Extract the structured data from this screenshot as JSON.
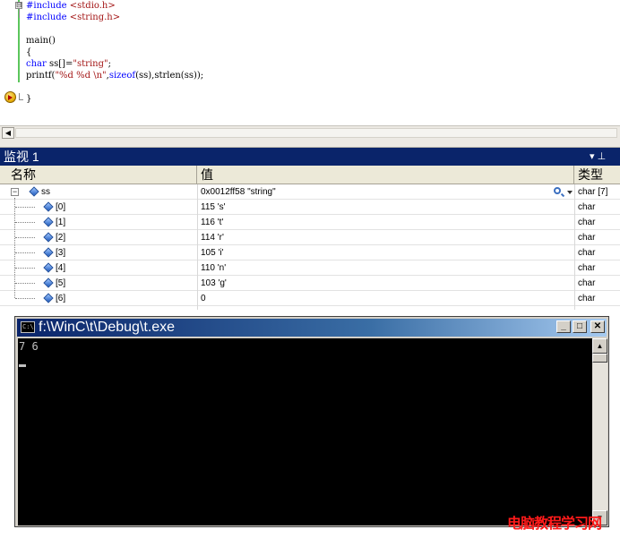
{
  "editor": {
    "lines": [
      {
        "segments": [
          {
            "t": "#include ",
            "c": "kw"
          },
          {
            "t": "<stdio.h>",
            "c": "str"
          }
        ]
      },
      {
        "segments": [
          {
            "t": "#include ",
            "c": "kw"
          },
          {
            "t": "<string.h>",
            "c": "str"
          }
        ]
      },
      {
        "segments": []
      },
      {
        "segments": [
          {
            "t": "main()",
            "c": ""
          }
        ]
      },
      {
        "segments": [
          {
            "t": "{",
            "c": ""
          }
        ]
      },
      {
        "segments": [
          {
            "t": "char",
            "c": "kw"
          },
          {
            "t": " ss[]=",
            "c": ""
          },
          {
            "t": "\"string\"",
            "c": "str"
          },
          {
            "t": ";",
            "c": ""
          }
        ]
      },
      {
        "segments": [
          {
            "t": "printf(",
            "c": ""
          },
          {
            "t": "\"%d %d \\n\"",
            "c": "str"
          },
          {
            "t": ",",
            "c": ""
          },
          {
            "t": "sizeof",
            "c": "kw"
          },
          {
            "t": "(ss),strlen(ss));",
            "c": ""
          }
        ]
      },
      {
        "segments": []
      },
      {
        "segments": [
          {
            "t": "}",
            "c": ""
          }
        ]
      }
    ],
    "outline_toggle": "⊟"
  },
  "watch": {
    "title": "监视 1",
    "pin_glyph": "▾ ⊥",
    "columns": {
      "name": "名称",
      "value": "值",
      "type": "类型"
    },
    "expander": "−",
    "rows": [
      {
        "name": "ss",
        "value": "0x0012ff58 \"string\"",
        "type": "char [7]"
      },
      {
        "name": "[0]",
        "value": "115 's'",
        "type": "char"
      },
      {
        "name": "[1]",
        "value": "116 't'",
        "type": "char"
      },
      {
        "name": "[2]",
        "value": "114 'r'",
        "type": "char"
      },
      {
        "name": "[3]",
        "value": "105 'i'",
        "type": "char"
      },
      {
        "name": "[4]",
        "value": "110 'n'",
        "type": "char"
      },
      {
        "name": "[5]",
        "value": "103 'g'",
        "type": "char"
      },
      {
        "name": "[6]",
        "value": "0",
        "type": "char"
      }
    ]
  },
  "console": {
    "title": "f:\\WinC\\t\\Debug\\t.exe",
    "icon_text": "C:\\",
    "output": "7 6",
    "buttons": {
      "minimize": "_",
      "maximize": "□",
      "close": "✕"
    },
    "scroll_up": "▲",
    "scroll_down": "▼"
  },
  "scrollbar": {
    "left_arrow": "◀"
  },
  "watermark": "电脑教程学习网",
  "colors": {
    "title_active": "#0a246a",
    "keyword": "#0000ff",
    "string": "#a31515",
    "watermark": "#ff1a1a"
  }
}
